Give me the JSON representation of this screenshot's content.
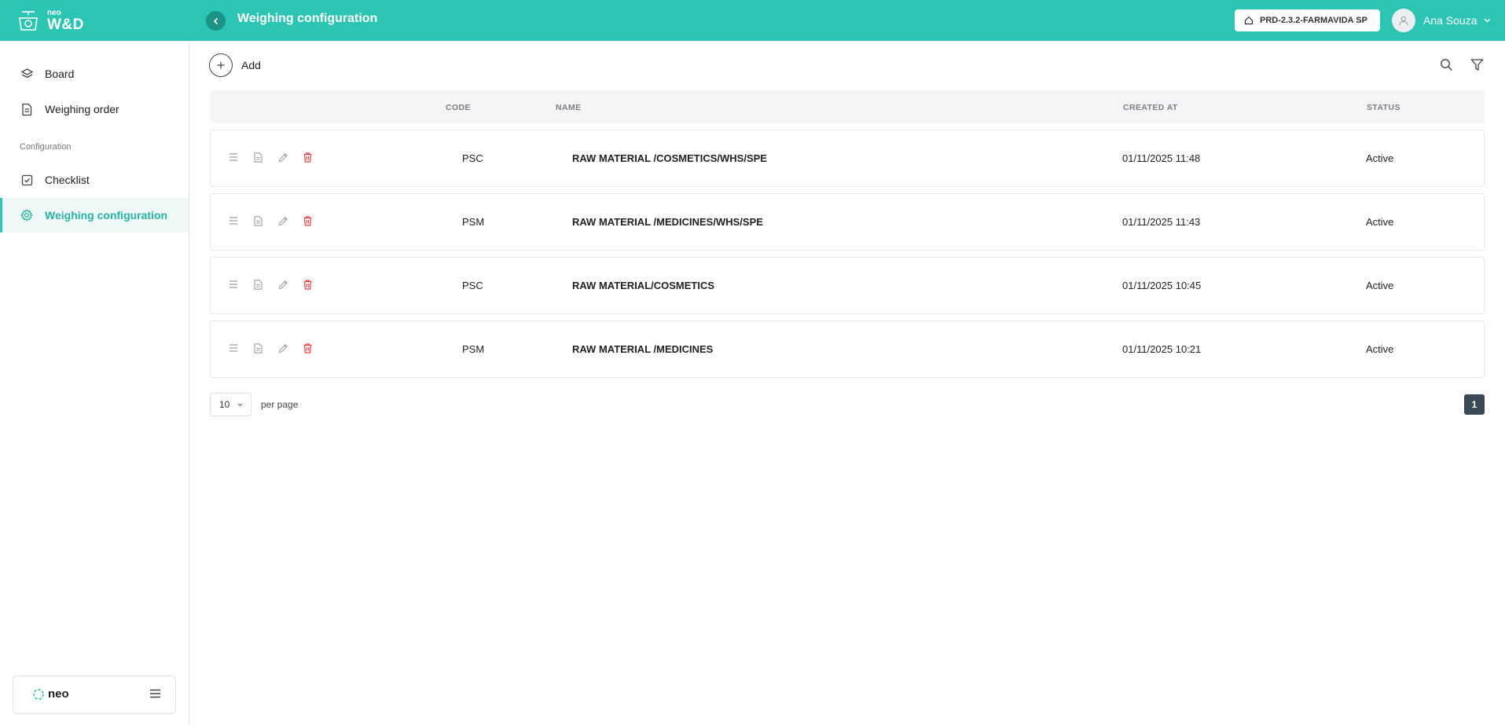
{
  "app": {
    "brand_small": "neo",
    "brand_name": "W&D",
    "page_title": "Weighing configuration",
    "environment": "PRD-2.3.2-FARMAVIDA SP",
    "user_name": "Ana Souza",
    "accent_color": "#2cc4b3"
  },
  "sidebar": {
    "items": [
      {
        "label": "Board",
        "icon": "layers-icon"
      },
      {
        "label": "Weighing order",
        "icon": "document-icon"
      }
    ],
    "section_label": "Configuration",
    "config_items": [
      {
        "label": "Checklist",
        "icon": "checkbox-icon"
      },
      {
        "label": "Weighing configuration",
        "icon": "gear-icon",
        "active": true
      }
    ],
    "footer_brand": "neo"
  },
  "toolbar": {
    "add_label": "Add"
  },
  "table": {
    "columns": {
      "code": "CODE",
      "name": "NAME",
      "created_at": "CREATED AT",
      "status": "STATUS"
    },
    "rows": [
      {
        "code": "PSC",
        "name": "RAW MATERIAL /COSMETICS/WHS/SPE",
        "created_at": "01/11/2025 11:48",
        "status": "Active"
      },
      {
        "code": "PSM",
        "name": "RAW MATERIAL /MEDICINES/WHS/SPE",
        "created_at": "01/11/2025 11:43",
        "status": "Active"
      },
      {
        "code": "PSC",
        "name": "RAW MATERIAL/COSMETICS",
        "created_at": "01/11/2025 10:45",
        "status": "Active"
      },
      {
        "code": "PSM",
        "name": "RAW MATERIAL /MEDICINES",
        "created_at": "01/11/2025 10:21",
        "status": "Active"
      }
    ]
  },
  "pagination": {
    "per_page_value": "10",
    "per_page_label": "per page",
    "current_page": "1"
  }
}
